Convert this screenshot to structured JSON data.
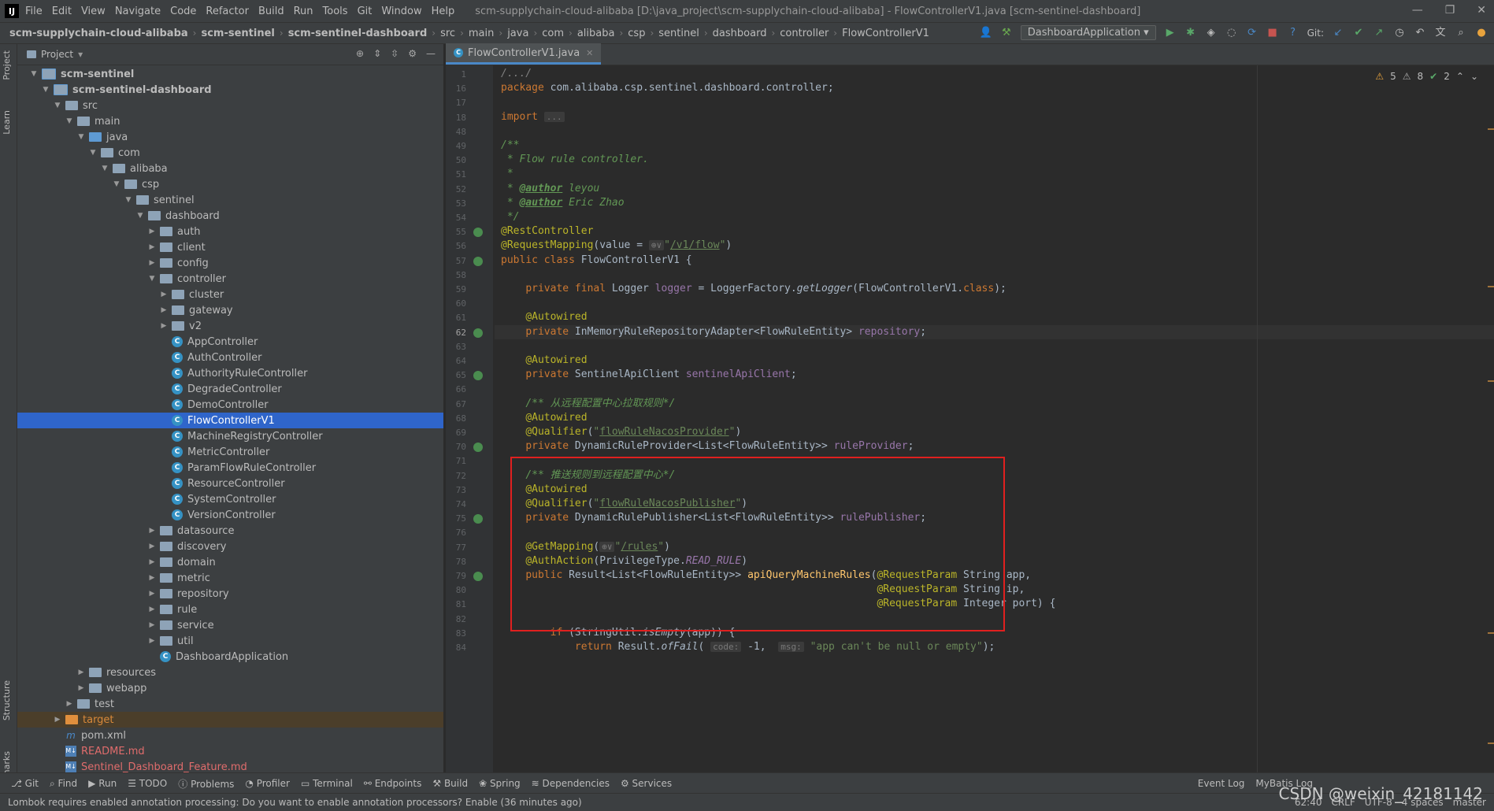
{
  "menubar": {
    "logo": "IJ",
    "items": [
      "File",
      "Edit",
      "View",
      "Navigate",
      "Code",
      "Refactor",
      "Build",
      "Run",
      "Tools",
      "Git",
      "Window",
      "Help"
    ],
    "window_title": "scm-supplychain-cloud-alibaba [D:\\java_project\\scm-supplychain-cloud-alibaba] - FlowControllerV1.java [scm-sentinel-dashboard]"
  },
  "breadcrumbs": [
    "scm-supplychain-cloud-alibaba",
    "scm-sentinel",
    "scm-sentinel-dashboard",
    "src",
    "main",
    "java",
    "com",
    "alibaba",
    "csp",
    "sentinel",
    "dashboard",
    "controller",
    "FlowControllerV1"
  ],
  "navbar": {
    "run_config": "DashboardApplication",
    "git_label": "Git:"
  },
  "left_strip": {
    "project": "Project",
    "learn": "Learn",
    "structure": "Structure",
    "bookmarks": "Bookmarks"
  },
  "project_panel": {
    "title": "Project",
    "tree": [
      {
        "label": "scm-sentinel",
        "level": 1,
        "type": "module",
        "open": true,
        "bold": true
      },
      {
        "label": "scm-sentinel-dashboard",
        "level": 2,
        "type": "module",
        "open": true,
        "bold": true
      },
      {
        "label": "src",
        "level": 3,
        "type": "folder",
        "open": true
      },
      {
        "label": "main",
        "level": 4,
        "type": "folder",
        "open": true
      },
      {
        "label": "java",
        "level": 5,
        "type": "src",
        "open": true
      },
      {
        "label": "com",
        "level": 6,
        "type": "folder",
        "open": true
      },
      {
        "label": "alibaba",
        "level": 7,
        "type": "folder",
        "open": true
      },
      {
        "label": "csp",
        "level": 8,
        "type": "folder",
        "open": true
      },
      {
        "label": "sentinel",
        "level": 9,
        "type": "folder",
        "open": true
      },
      {
        "label": "dashboard",
        "level": 10,
        "type": "folder",
        "open": true
      },
      {
        "label": "auth",
        "level": 11,
        "type": "folder",
        "open": false
      },
      {
        "label": "client",
        "level": 11,
        "type": "folder",
        "open": false
      },
      {
        "label": "config",
        "level": 11,
        "type": "folder",
        "open": false
      },
      {
        "label": "controller",
        "level": 11,
        "type": "folder",
        "open": true
      },
      {
        "label": "cluster",
        "level": 12,
        "type": "folder",
        "open": false
      },
      {
        "label": "gateway",
        "level": 12,
        "type": "folder",
        "open": false
      },
      {
        "label": "v2",
        "level": 12,
        "type": "folder",
        "open": false
      },
      {
        "label": "AppController",
        "level": 12,
        "type": "class"
      },
      {
        "label": "AuthController",
        "level": 12,
        "type": "class"
      },
      {
        "label": "AuthorityRuleController",
        "level": 12,
        "type": "class"
      },
      {
        "label": "DegradeController",
        "level": 12,
        "type": "class"
      },
      {
        "label": "DemoController",
        "level": 12,
        "type": "class"
      },
      {
        "label": "FlowControllerV1",
        "level": 12,
        "type": "class",
        "selected": true
      },
      {
        "label": "MachineRegistryController",
        "level": 12,
        "type": "class"
      },
      {
        "label": "MetricController",
        "level": 12,
        "type": "class"
      },
      {
        "label": "ParamFlowRuleController",
        "level": 12,
        "type": "class"
      },
      {
        "label": "ResourceController",
        "level": 12,
        "type": "class"
      },
      {
        "label": "SystemController",
        "level": 12,
        "type": "class"
      },
      {
        "label": "VersionController",
        "level": 12,
        "type": "class"
      },
      {
        "label": "datasource",
        "level": 11,
        "type": "folder",
        "open": false
      },
      {
        "label": "discovery",
        "level": 11,
        "type": "folder",
        "open": false
      },
      {
        "label": "domain",
        "level": 11,
        "type": "folder",
        "open": false
      },
      {
        "label": "metric",
        "level": 11,
        "type": "folder",
        "open": false
      },
      {
        "label": "repository",
        "level": 11,
        "type": "folder",
        "open": false
      },
      {
        "label": "rule",
        "level": 11,
        "type": "folder",
        "open": false
      },
      {
        "label": "service",
        "level": 11,
        "type": "folder",
        "open": false
      },
      {
        "label": "util",
        "level": 11,
        "type": "folder",
        "open": false
      },
      {
        "label": "DashboardApplication",
        "level": 11,
        "type": "class"
      },
      {
        "label": "resources",
        "level": 5,
        "type": "folder",
        "open": false
      },
      {
        "label": "webapp",
        "level": 5,
        "type": "folder",
        "open": false
      },
      {
        "label": "test",
        "level": 4,
        "type": "folder",
        "open": false
      },
      {
        "label": "target",
        "level": 3,
        "type": "target",
        "open": false,
        "highlight": true
      },
      {
        "label": "pom.xml",
        "level": 3,
        "type": "maven"
      },
      {
        "label": "README.md",
        "level": 3,
        "type": "md",
        "red": true
      },
      {
        "label": "Sentinel_Dashboard_Feature.md",
        "level": 3,
        "type": "md",
        "red": true
      }
    ]
  },
  "editor": {
    "tab": "FlowControllerV1.java",
    "inspections": {
      "warnings": "5",
      "weak": "8",
      "ok": "2"
    },
    "lines": [
      {
        "n": "1",
        "html": "<span class='cm'>/.../</span>"
      },
      {
        "n": "16",
        "html": "<span class='kw'>package</span> com.alibaba.csp.sentinel.dashboard.controller;"
      },
      {
        "n": "17",
        "html": ""
      },
      {
        "n": "18",
        "html": "<span class='kw'>import</span> <span class='hint'>...</span>"
      },
      {
        "n": "48",
        "html": ""
      },
      {
        "n": "49",
        "html": "<span class='dc'>/**</span>"
      },
      {
        "n": "50",
        "html": "<span class='dc'> * Flow rule controller.</span>"
      },
      {
        "n": "51",
        "html": "<span class='dc'> *</span>"
      },
      {
        "n": "52",
        "html": "<span class='dc'> * <b><u>@author</u></b> leyou</span>"
      },
      {
        "n": "53",
        "html": "<span class='dc'> * <b><u>@author</u></b> Eric Zhao</span>"
      },
      {
        "n": "54",
        "html": "<span class='dc'> */</span>"
      },
      {
        "n": "55",
        "html": "<span class='an'>@RestController</span>",
        "gi": true
      },
      {
        "n": "56",
        "html": "<span class='an'>@RequestMapping</span>(value = <span class='hint'>⊕∨</span><span class='str'>\"<u>/v1/flow</u>\"</span>)"
      },
      {
        "n": "57",
        "html": "<span class='kw'>public class</span> FlowControllerV1 {",
        "gi": true
      },
      {
        "n": "58",
        "html": ""
      },
      {
        "n": "59",
        "html": "    <span class='kw'>private final</span> Logger <span class='fld'>logger</span> = LoggerFactory.<span class='it'>getLogger</span>(FlowControllerV1.<span class='kw'>class</span>);"
      },
      {
        "n": "60",
        "html": ""
      },
      {
        "n": "61",
        "html": "    <span class='an'>@Autowired</span>"
      },
      {
        "n": "62",
        "html": "    <span class='kw'>private</span> InMemoryRuleRepositoryAdapter&lt;FlowRuleEntity&gt; <span class='fld'>repository</span>;",
        "gi": true,
        "cur": true
      },
      {
        "n": "63",
        "html": ""
      },
      {
        "n": "64",
        "html": "    <span class='an'>@Autowired</span>"
      },
      {
        "n": "65",
        "html": "    <span class='kw'>private</span> SentinelApiClient <span class='fld'>sentinelApiClient</span>;",
        "gi": true
      },
      {
        "n": "66",
        "html": ""
      },
      {
        "n": "67",
        "html": "    <span class='dc'>/** 从远程配置中心拉取规则*/</span>"
      },
      {
        "n": "68",
        "html": "    <span class='an'>@Autowired</span>"
      },
      {
        "n": "69",
        "html": "    <span class='an'>@Qualifier</span>(<span class='str'>\"<u>flowRuleNacosProvider</u>\"</span>)"
      },
      {
        "n": "70",
        "html": "    <span class='kw'>private</span> DynamicRuleProvider&lt;List&lt;FlowRuleEntity&gt;&gt; <span class='fld'>ruleProvider</span>;",
        "gi": true
      },
      {
        "n": "71",
        "html": ""
      },
      {
        "n": "72",
        "html": "    <span class='dc'>/** 推送规则到远程配置中心*/</span>"
      },
      {
        "n": "73",
        "html": "    <span class='an'>@Autowired</span>"
      },
      {
        "n": "74",
        "html": "    <span class='an'>@Qualifier</span>(<span class='str'>\"<u>flowRuleNacosPublisher</u>\"</span>)"
      },
      {
        "n": "75",
        "html": "    <span class='kw'>private</span> DynamicRulePublisher&lt;List&lt;FlowRuleEntity&gt;&gt; <span class='fld'>rulePublisher</span>;",
        "gi": true
      },
      {
        "n": "76",
        "html": ""
      },
      {
        "n": "77",
        "html": "    <span class='an'>@GetMapping</span>(<span class='hint'>⊕∨</span><span class='str'>\"<u>/rules</u>\"</span>)"
      },
      {
        "n": "78",
        "html": "    <span class='an'>@AuthAction</span>(PrivilegeType.<span class='fld it'>READ_RULE</span>)"
      },
      {
        "n": "79",
        "html": "    <span class='kw'>public</span> Result&lt;List&lt;FlowRuleEntity&gt;&gt; <span class='fn'>apiQueryMachineRules</span>(<span class='an'>@RequestParam</span> String app,",
        "gi": true
      },
      {
        "n": "80",
        "html": "                                                             <span class='an'>@RequestParam</span> String ip,"
      },
      {
        "n": "81",
        "html": "                                                             <span class='an'>@RequestParam</span> Integer port) {"
      },
      {
        "n": "82",
        "html": ""
      },
      {
        "n": "83",
        "html": "        <span class='kw'>if</span> (StringUtil.<span class='it'>isEmpty</span>(app)) {"
      },
      {
        "n": "84",
        "html": "            <span class='kw'>return</span> Result.<span class='it'>ofFail</span>( <span class='hint'>code:</span> -1,  <span class='hint'>msg:</span> <span class='str'>\"app can't be null or empty\"</span>);"
      }
    ]
  },
  "toolwindows": [
    "Git",
    "Find",
    "Run",
    "TODO",
    "Problems",
    "Profiler",
    "Terminal",
    "Endpoints",
    "Build",
    "Spring",
    "Dependencies",
    "Services"
  ],
  "toolwindows_right": [
    "Event Log",
    "MyBatis Log"
  ],
  "status": {
    "message": "Lombok requires enabled annotation processing: Do you want to enable annotation processors? Enable (36 minutes ago)",
    "position": "62:40",
    "line_sep": "CRLF",
    "encoding": "UTF-8",
    "indent": "4 spaces",
    "branch": "master"
  },
  "watermark": "CSDN @weixin_42181142"
}
